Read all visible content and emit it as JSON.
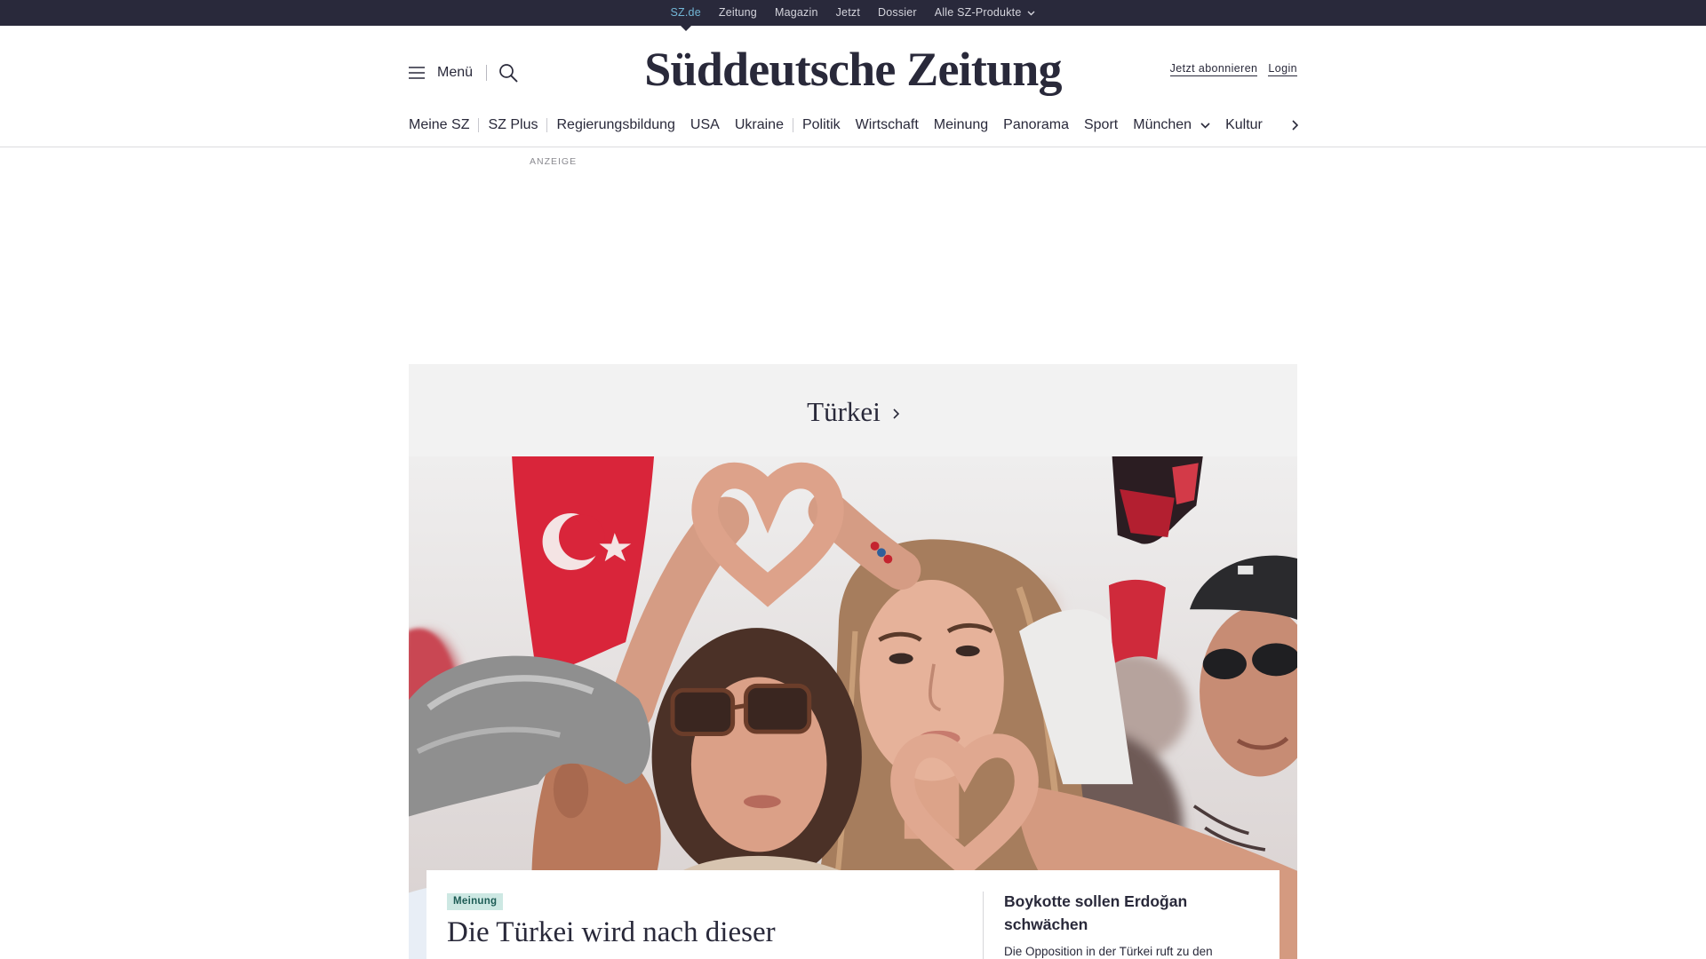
{
  "topbar": {
    "items": [
      {
        "label": "SZ.de",
        "active": true
      },
      {
        "label": "Zeitung"
      },
      {
        "label": "Magazin"
      },
      {
        "label": "Jetzt"
      },
      {
        "label": "Dossier"
      },
      {
        "label": "Alle SZ-Produkte",
        "icon": "chevron-down-icon"
      }
    ]
  },
  "header": {
    "menu_label": "Menü",
    "menu_icon": "hamburger-icon",
    "search_icon": "search-icon",
    "logo": "Süddeutsche Zeitung",
    "subscribe_label": "Jetzt abonnieren",
    "login_label": "Login"
  },
  "nav": {
    "items": [
      "Meine SZ",
      "SZ Plus",
      "Regierungsbildung",
      "USA",
      "Ukraine",
      "Politik",
      "Wirtschaft",
      "Meinung",
      "Panorama",
      "Sport",
      "München",
      "Kultur"
    ],
    "dropdown_icon": "chevron-down-icon",
    "more_icon": "chevron-right-icon"
  },
  "ad": {
    "label": "ANZEIGE"
  },
  "section": {
    "title": "Türkei",
    "title_icon": "chevron-right-icon",
    "lead": {
      "badge": "Meinung",
      "headline": "Die Türkei wird nach dieser"
    },
    "secondary": {
      "headline": "Boykotte sollen Erdoğan schwächen",
      "teaser": "Die Opposition in der Türkei ruft zu den"
    }
  },
  "colors": {
    "topbar_bg": "#29293b",
    "topbar_active": "#72b6d6",
    "text": "#29293a",
    "section_bg": "#f2f2f2",
    "badge_bg": "#cde8e3",
    "badge_text": "#1d5c55"
  }
}
